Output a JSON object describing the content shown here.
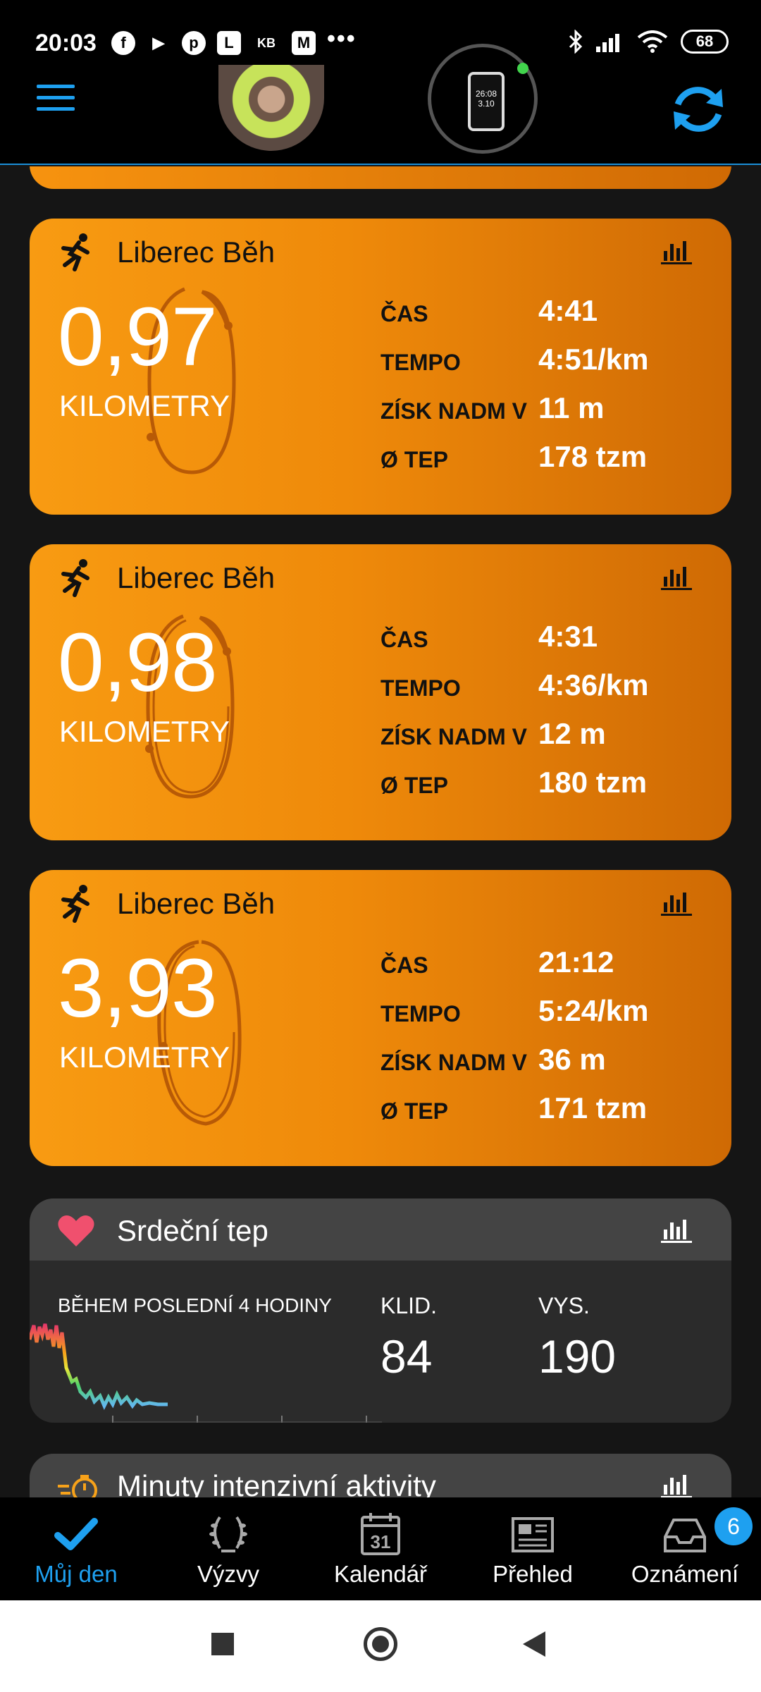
{
  "status_bar": {
    "time": "20:03",
    "left_icons": [
      "facebook-icon",
      "play-store-icon",
      "pinterest-icon",
      "lidl-plus-icon",
      "kb-icon",
      "gmail-icon"
    ],
    "kb_text": "KB",
    "more": "•••",
    "battery": "68"
  },
  "header": {
    "avatar": "profile-avatar",
    "watch_time": "26:08",
    "watch_date": "3.10",
    "sync_icon": "sync-icon",
    "accent": "#1ea0f0"
  },
  "activities": [
    {
      "title": "Liberec Běh",
      "distance": "0,97",
      "unit": "KILOMETRY",
      "metrics": [
        {
          "label": "ČAS",
          "value": "4:41"
        },
        {
          "label": "TEMPO",
          "value": "4:51/km"
        },
        {
          "label": "ZÍSK NADM V",
          "value": "11 m"
        },
        {
          "label": "Ø TEP",
          "value": "178 tzm"
        }
      ]
    },
    {
      "title": "Liberec Běh",
      "distance": "0,98",
      "unit": "KILOMETRY",
      "metrics": [
        {
          "label": "ČAS",
          "value": "4:31"
        },
        {
          "label": "TEMPO",
          "value": "4:36/km"
        },
        {
          "label": "ZÍSK NADM V",
          "value": "12 m"
        },
        {
          "label": "Ø TEP",
          "value": "180 tzm"
        }
      ]
    },
    {
      "title": "Liberec Běh",
      "distance": "3,93",
      "unit": "KILOMETRY",
      "metrics": [
        {
          "label": "ČAS",
          "value": "21:12"
        },
        {
          "label": "TEMPO",
          "value": "5:24/km"
        },
        {
          "label": "ZÍSK NADM V",
          "value": "36 m"
        },
        {
          "label": "Ø TEP",
          "value": "171 tzm"
        }
      ]
    }
  ],
  "heart_rate": {
    "title": "Srdeční tep",
    "subtitle": "BĚHEM POSLEDNÍ 4 HODINY",
    "resting_label": "KLID.",
    "resting_value": "84",
    "high_label": "VYS.",
    "high_value": "190"
  },
  "intensity": {
    "title": "Minuty intenzivní aktivity"
  },
  "bottom_nav": [
    {
      "label": "Můj den",
      "icon": "checkmark-icon",
      "active": true
    },
    {
      "label": "Výzvy",
      "icon": "laurel-icon",
      "active": false
    },
    {
      "label": "Kalendář",
      "icon": "calendar-icon",
      "active": false,
      "day": "31"
    },
    {
      "label": "Přehled",
      "icon": "newsfeed-icon",
      "active": false
    },
    {
      "label": "Oznámení",
      "icon": "inbox-icon",
      "active": false,
      "badge": "6"
    }
  ]
}
